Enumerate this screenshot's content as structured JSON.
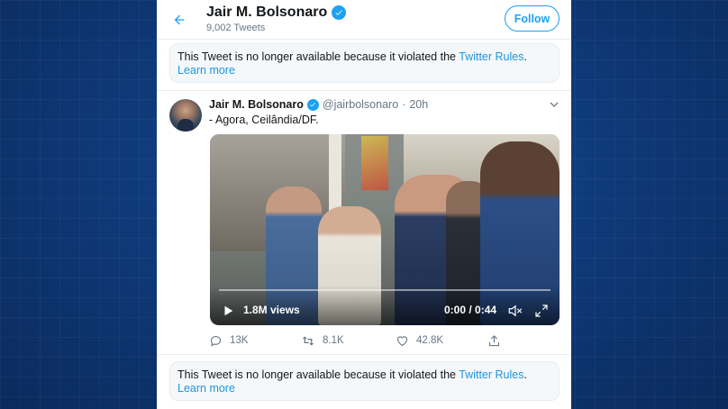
{
  "header": {
    "name": "Jair M. Bolsonaro",
    "tweet_count": "9,002 Tweets",
    "follow_label": "Follow"
  },
  "notice_top": {
    "text": "This Tweet is no longer available because it violated the ",
    "link": "Twitter Rules",
    "suffix": ". ",
    "learn_more": "Learn more"
  },
  "tweet": {
    "name": "Jair M. Bolsonaro",
    "handle": "@jairbolsonaro",
    "dot": "·",
    "time": "20h",
    "text": "- Agora, Ceilândia/DF.",
    "video": {
      "views": "1.8M views",
      "timecode": "0:00 / 0:44",
      "progress": 0
    },
    "actions": {
      "replies": "13K",
      "retweets": "8.1K",
      "likes": "42.8K"
    }
  },
  "notice_bottom": {
    "text": "This Tweet is no longer available because it violated the ",
    "link": "Twitter Rules",
    "suffix": ". ",
    "learn_more": "Learn more"
  },
  "colors": {
    "accent": "#1da1f2",
    "link": "#1b95e0",
    "background": "#0f3a7a"
  }
}
